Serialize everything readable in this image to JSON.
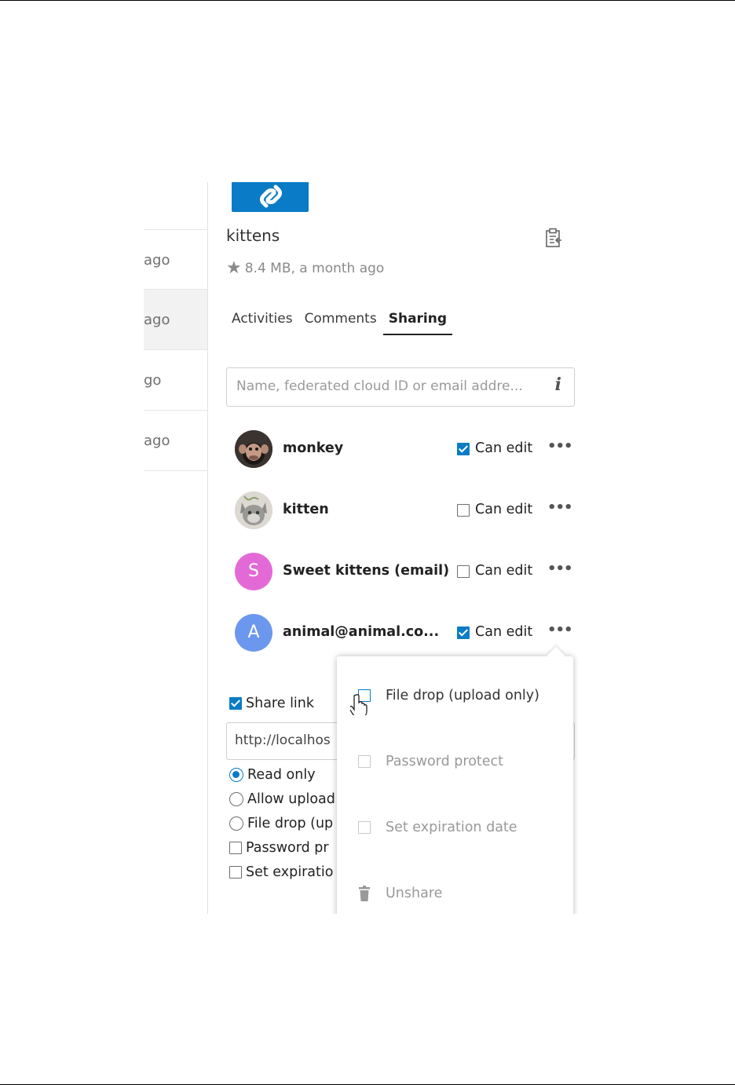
{
  "file": {
    "name": "kittens",
    "meta": "8.4 MB, a month ago"
  },
  "file_list": {
    "rows": [
      "ago",
      "ago",
      "go",
      "ago"
    ]
  },
  "tabs": [
    {
      "label": "Activities"
    },
    {
      "label": "Comments"
    },
    {
      "label": "Sharing",
      "active": true
    }
  ],
  "search": {
    "placeholder": "Name, federated cloud ID or email addre..."
  },
  "shares": [
    {
      "name": "monkey",
      "avatar": "monkey-photo",
      "can_edit": true,
      "can_edit_label": "Can edit"
    },
    {
      "name": "kitten",
      "avatar": "kitten-photo",
      "can_edit": false,
      "can_edit_label": "Can edit"
    },
    {
      "name": "Sweet kittens (email)",
      "avatar_letter": "S",
      "avatar_color": "#e36ad6",
      "can_edit": false,
      "can_edit_label": "Can edit"
    },
    {
      "name": "animal@animal.co...",
      "avatar_letter": "A",
      "avatar_color": "#6c97ee",
      "can_edit": true,
      "can_edit_label": "Can edit"
    }
  ],
  "share_link": {
    "label": "Share link",
    "checked": true,
    "url": "http://localhos",
    "options": {
      "read_only": "Read only",
      "allow_upload": "Allow upload",
      "file_drop": "File drop (up",
      "password": "Password pr",
      "expiration": "Set expiratio"
    }
  },
  "menu": {
    "items": [
      {
        "label": "File drop (upload only)"
      },
      {
        "label": "Password protect"
      },
      {
        "label": "Set expiration date"
      },
      {
        "label": "Unshare"
      }
    ]
  },
  "colors": {
    "accent": "#0a7bc6"
  }
}
